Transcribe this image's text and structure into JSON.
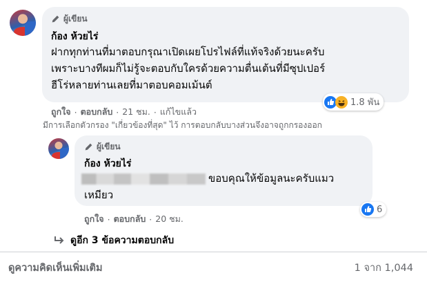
{
  "comment": {
    "author_badge": "ผู้เขียน",
    "author_name": "ก้อง ห้วยไร่",
    "lines": [
      "ฝากทุกท่านที่มาตอบกรุณาเปิดเผยโปรไฟล์ที่แท้จริงด้วยนะครับ",
      "เพราะบางทีผมก็ไม่รู้จะตอบกับใครด้วยความตื่นเต้นที่มีซุปเปอร์",
      "ฮีโร่หลายท่านเลยที่มาตอบคอมเม้นต์"
    ],
    "reaction_count": "1.8 พัน",
    "like_label": "ถูกใจ",
    "reply_label": "ตอบกลับ",
    "time": "21 ชม.",
    "edited_label": "แก้ไขแล้ว",
    "separator": "·",
    "filter_note": "มีการเลือกตัวกรอง \"เกี่ยวข้องที่สุด\" ไว้ การตอบกลับบางส่วนจึงอาจถูกกรองออก"
  },
  "reply": {
    "author_badge": "ผู้เขียน",
    "author_name": "ก้อง ห้วยไร่",
    "text_after_blur": "ขอบคุณให้ข้อมูลนะครับแมว",
    "text_line2": "เหมียว",
    "reaction_count": "6",
    "like_label": "ถูกใจ",
    "reply_label": "ตอบกลับ",
    "time": "20 ชม."
  },
  "more_replies": "ดูอีก 3 ข้อความตอบกลับ",
  "footer": {
    "more_comments": "ดูความคิดเห็นเพิ่มเติม",
    "count": "1 จาก 1,044"
  },
  "colors": {
    "bubble": "#f0f2f5",
    "secondary_text": "#65676b",
    "like_blue": "#1877f2",
    "haha_yellow": "#f7b125"
  }
}
